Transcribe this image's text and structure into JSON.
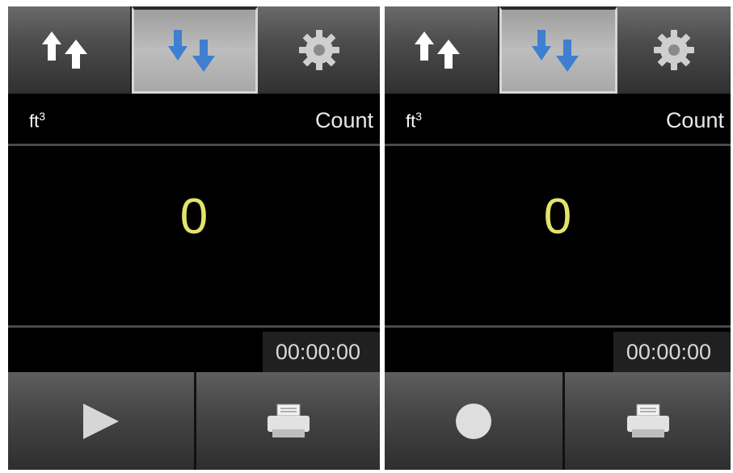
{
  "panels": [
    {
      "unit_base": "ft",
      "unit_exp": "3",
      "count_label": "Count",
      "count_value": "0",
      "timer": "00:00:00",
      "tabs": [
        "sort-ascending-icon",
        "sort-descending-icon",
        "gear-icon"
      ],
      "active_tab": 1,
      "buttons": [
        "play-icon",
        "printer-icon"
      ]
    },
    {
      "unit_base": "ft",
      "unit_exp": "3",
      "count_label": "Count",
      "count_value": "0",
      "timer": "00:00:00",
      "tabs": [
        "sort-ascending-icon",
        "sort-descending-icon",
        "gear-icon"
      ],
      "active_tab": 1,
      "buttons": [
        "record-icon",
        "printer-icon"
      ]
    }
  ],
  "colors": {
    "background": "#000000",
    "count_value": "#e3e36a",
    "arrow_white": "#ffffff",
    "arrow_blue": "#3e7fcf"
  }
}
